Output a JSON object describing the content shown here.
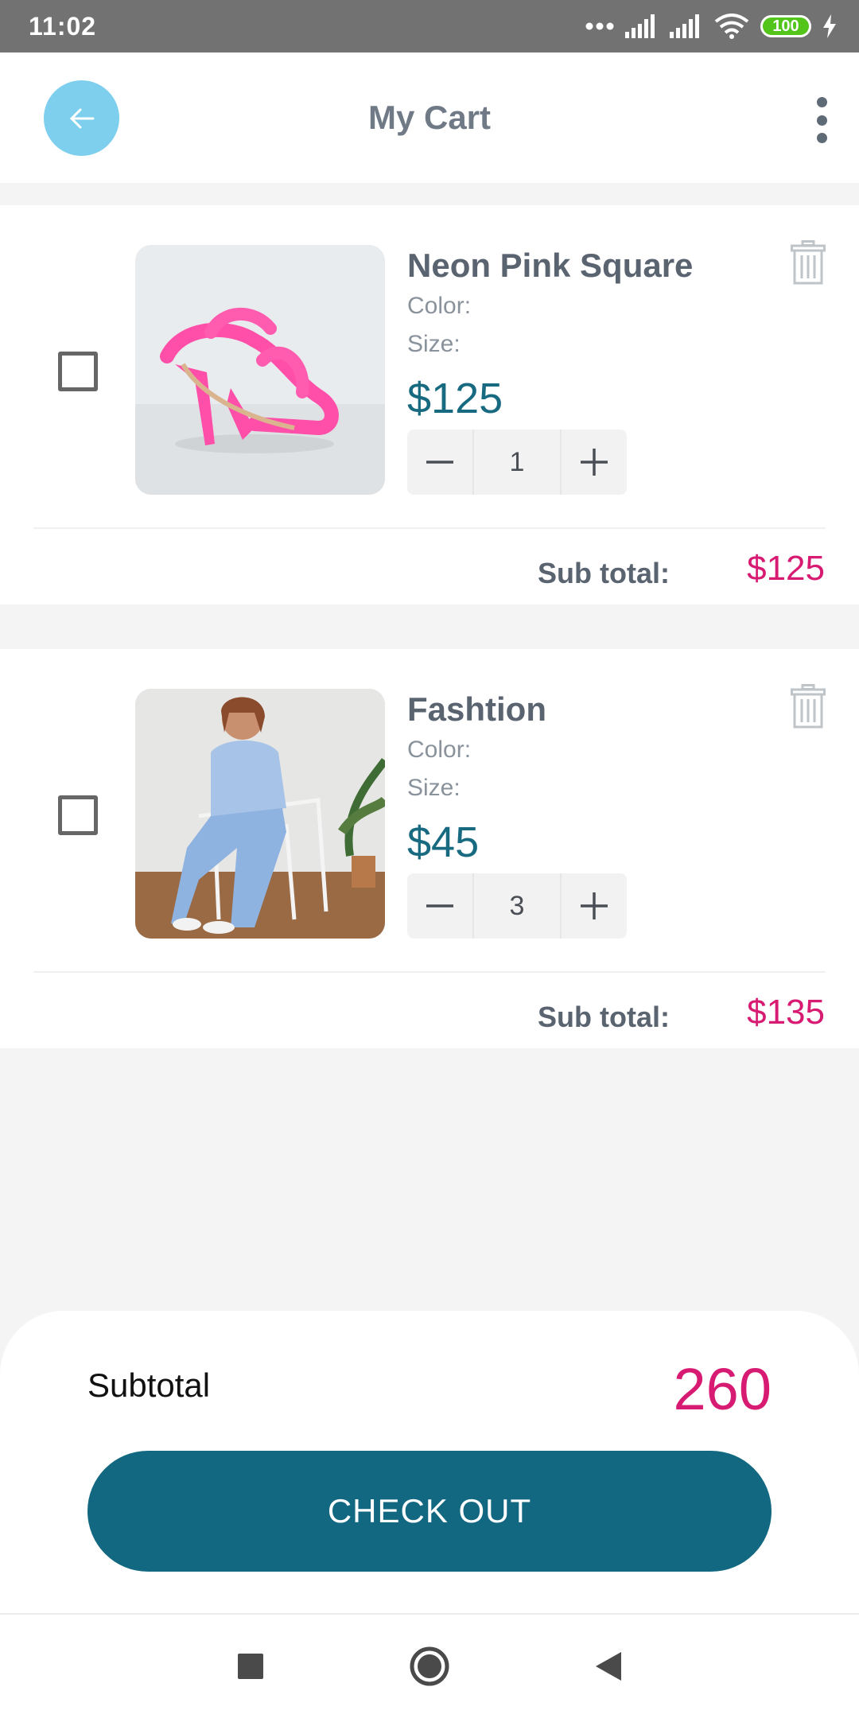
{
  "status_bar": {
    "time": "11:02",
    "battery": "100",
    "icons": [
      "dots-icon",
      "signal-icon",
      "signal-icon",
      "wifi-icon",
      "battery-icon",
      "charging-icon"
    ]
  },
  "header": {
    "title": "My Cart",
    "back_icon": "arrow-left-icon",
    "menu_icon": "more-vertical-icon"
  },
  "colors": {
    "accent": "#126880",
    "price": "#176a80",
    "total": "#d81b72",
    "back_button": "#7dcfed"
  },
  "items": [
    {
      "name": "Neon Pink Square",
      "color_label": "Color:",
      "size_label": "Size:",
      "price": "$125",
      "quantity": "1",
      "subtotal_label": "Sub total:",
      "subtotal": "$125",
      "checked": false,
      "image": "pink-heeled-sandal-photo"
    },
    {
      "name": "Fashtion",
      "color_label": "Color:",
      "size_label": "Size:",
      "price": "$45",
      "quantity": "3",
      "subtotal_label": "Sub total:",
      "subtotal": "$135",
      "checked": false,
      "image": "woman-in-denim-photo"
    }
  ],
  "summary": {
    "label": "Subtotal",
    "total": "260",
    "checkout_label": "CHECK OUT"
  },
  "nav": {
    "icons": [
      "square-icon",
      "circle-icon",
      "triangle-back-icon"
    ]
  }
}
